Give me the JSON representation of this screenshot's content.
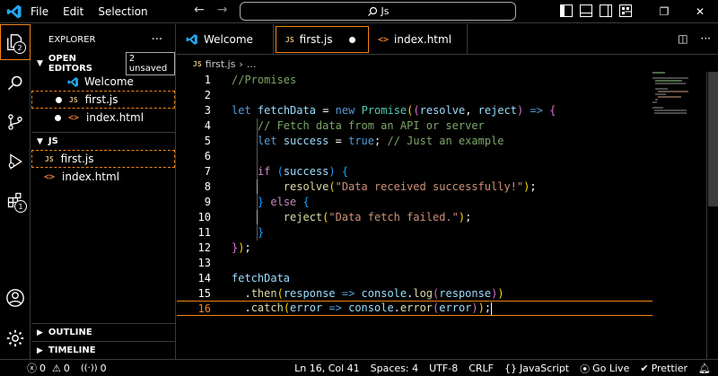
{
  "menu": {
    "file": "File",
    "edit": "Edit",
    "selection": "Selection"
  },
  "command_center": {
    "text": "Js"
  },
  "explorer": {
    "title": "EXPLORER",
    "open_editors": {
      "label": "OPEN EDITORS",
      "badge": "2 unsaved",
      "items": [
        {
          "label": "Welcome"
        },
        {
          "label": "first.js"
        },
        {
          "label": "index.html"
        }
      ]
    },
    "folder": {
      "label": "JS",
      "items": [
        {
          "label": "first.js"
        },
        {
          "label": "index.html"
        }
      ]
    },
    "outline": "OUTLINE",
    "timeline": "TIMELINE"
  },
  "activity_badges": {
    "explorer": "2",
    "extensions": "1"
  },
  "tabs": [
    {
      "label": "Welcome"
    },
    {
      "label": "first.js"
    },
    {
      "label": "index.html"
    }
  ],
  "breadcrumb": {
    "file": "first.js",
    "rest": "..."
  },
  "editor": {
    "line_numbers": [
      "1",
      "2",
      "3",
      "4",
      "5",
      "6",
      "7",
      "8",
      "9",
      "10",
      "11",
      "12",
      "13",
      "14",
      "15",
      "16"
    ]
  },
  "status": {
    "errors": "0",
    "warnings": "0",
    "ports": "0",
    "position": "Ln 16, Col 41",
    "spaces": "Spaces: 4",
    "encoding": "UTF-8",
    "eol": "CRLF",
    "language": "JavaScript",
    "golive": "Go Live",
    "prettier": "Prettier"
  },
  "colors": {
    "accent": "#f38518",
    "comment": "#7ca668",
    "keyword": "#569cd6",
    "string": "#ce9178"
  }
}
